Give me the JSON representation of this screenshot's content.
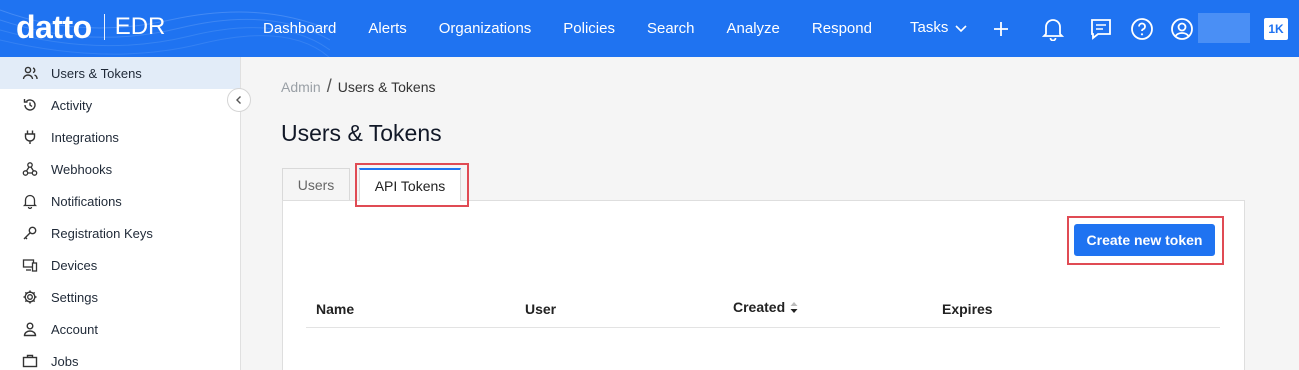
{
  "brand": {
    "logo": "datto",
    "product": "EDR",
    "accent": "#1f73f1"
  },
  "nav": {
    "items": [
      "Dashboard",
      "Alerts",
      "Organizations",
      "Policies",
      "Search",
      "Analyze",
      "Respond"
    ],
    "tasks_label": "Tasks",
    "badge": "1K"
  },
  "sidebar": {
    "items": [
      {
        "label": "Users & Tokens",
        "icon": "users-icon",
        "active": true
      },
      {
        "label": "Activity",
        "icon": "history-icon"
      },
      {
        "label": "Integrations",
        "icon": "plug-icon"
      },
      {
        "label": "Webhooks",
        "icon": "webhook-icon"
      },
      {
        "label": "Notifications",
        "icon": "bell-icon"
      },
      {
        "label": "Registration Keys",
        "icon": "key-icon"
      },
      {
        "label": "Devices",
        "icon": "devices-icon"
      },
      {
        "label": "Settings",
        "icon": "gear-icon"
      },
      {
        "label": "Account",
        "icon": "person-icon"
      },
      {
        "label": "Jobs",
        "icon": "briefcase-icon"
      }
    ]
  },
  "breadcrumb": {
    "parent": "Admin",
    "separator": "/",
    "current": "Users & Tokens"
  },
  "page": {
    "title": "Users & Tokens"
  },
  "tabs": [
    {
      "label": "Users",
      "active": false
    },
    {
      "label": "API Tokens",
      "active": true
    }
  ],
  "actions": {
    "create_label": "Create new token"
  },
  "table": {
    "columns": [
      "Name",
      "User",
      "Created",
      "Expires"
    ]
  },
  "colors": {
    "highlight": "#e04b54",
    "sidebar_active": "#e2ecf8"
  }
}
